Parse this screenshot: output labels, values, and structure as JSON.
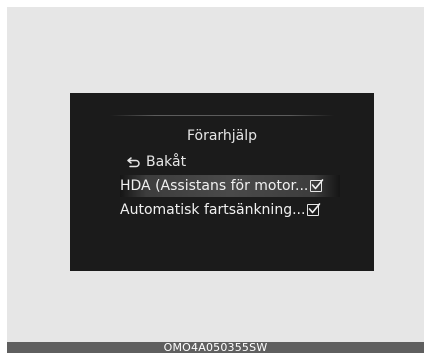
{
  "screen": {
    "title": "Förarhjälp",
    "back_label": "Bakåt",
    "items": [
      {
        "label": "HDA (Assistans för motor...",
        "checked": true,
        "selected": true
      },
      {
        "label": "Automatisk fartsänkning...",
        "checked": true,
        "selected": false
      }
    ]
  },
  "caption": "OMO4A050355SW",
  "colors": {
    "display_bg": "#1b1b1b",
    "highlight": "#4a4a4a",
    "text": "#e6e6e6",
    "frame_bg": "#e6e6e6",
    "caption_bg": "#5f5f5f"
  },
  "icons": {
    "back": "back-arrow-icon",
    "checkbox": "checkbox-checked-icon"
  }
}
